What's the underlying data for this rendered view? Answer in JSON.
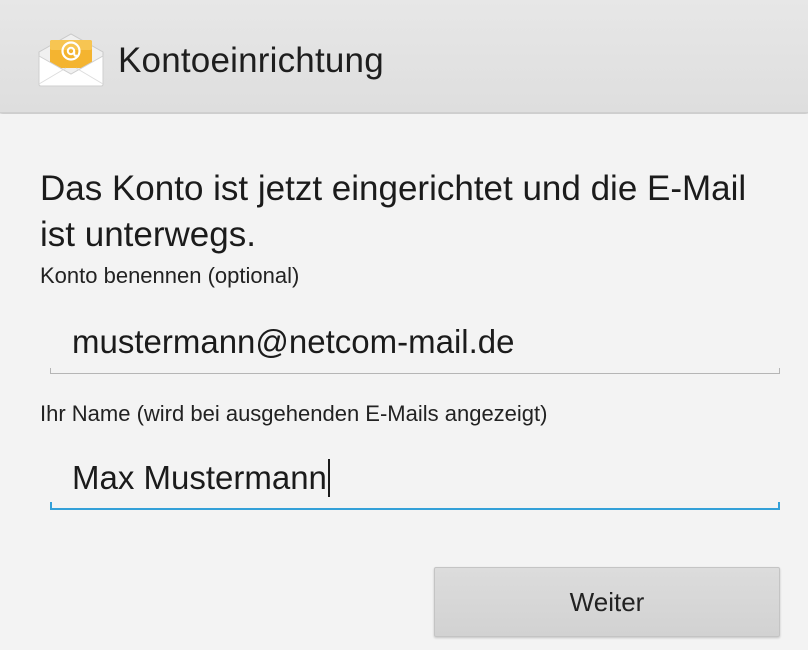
{
  "action_bar": {
    "title": "Kontoeinrichtung",
    "icon": "email-app-icon",
    "accent_color": "#f2b531"
  },
  "message": {
    "headline": "Das Konto ist jetzt eingerichtet und die E-Mail ist unterwegs."
  },
  "account_name": {
    "label": "Konto benennen (optional)",
    "value": "mustermann@netcom-mail.de"
  },
  "your_name": {
    "label": "Ihr Name (wird bei ausgehenden E-Mails angezeigt)",
    "value": "Max Mustermann",
    "focused": true,
    "focus_color": "#33a0d8"
  },
  "actions": {
    "next_label": "Weiter"
  }
}
